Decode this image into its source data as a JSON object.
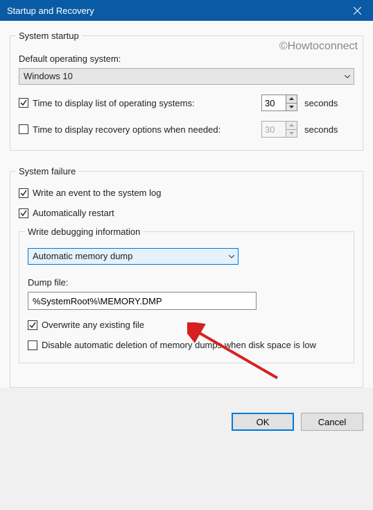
{
  "window": {
    "title": "Startup and Recovery"
  },
  "watermark": "©Howtoconnect",
  "startup": {
    "legend": "System startup",
    "defaultOSLabel": "Default operating system:",
    "defaultOSValue": "Windows 10",
    "displayListLabel": "Time to display list of operating systems:",
    "displayListChecked": true,
    "displayListSeconds": "30",
    "displayRecoveryLabel": "Time to display recovery options when needed:",
    "displayRecoveryChecked": false,
    "displayRecoverySeconds": "30",
    "secondsUnit": "seconds"
  },
  "failure": {
    "legend": "System failure",
    "writeEventLabel": "Write an event to the system log",
    "writeEventChecked": true,
    "autoRestartLabel": "Automatically restart",
    "autoRestartChecked": true
  },
  "debug": {
    "legend": "Write debugging information",
    "dumpTypeValue": "Automatic memory dump",
    "dumpFileLabel": "Dump file:",
    "dumpFileValue": "%SystemRoot%\\MEMORY.DMP",
    "overwriteLabel": "Overwrite any existing file",
    "overwriteChecked": true,
    "disableDeleteLabel": "Disable automatic deletion of memory dumps when disk space is low",
    "disableDeleteChecked": false
  },
  "buttons": {
    "ok": "OK",
    "cancel": "Cancel"
  }
}
